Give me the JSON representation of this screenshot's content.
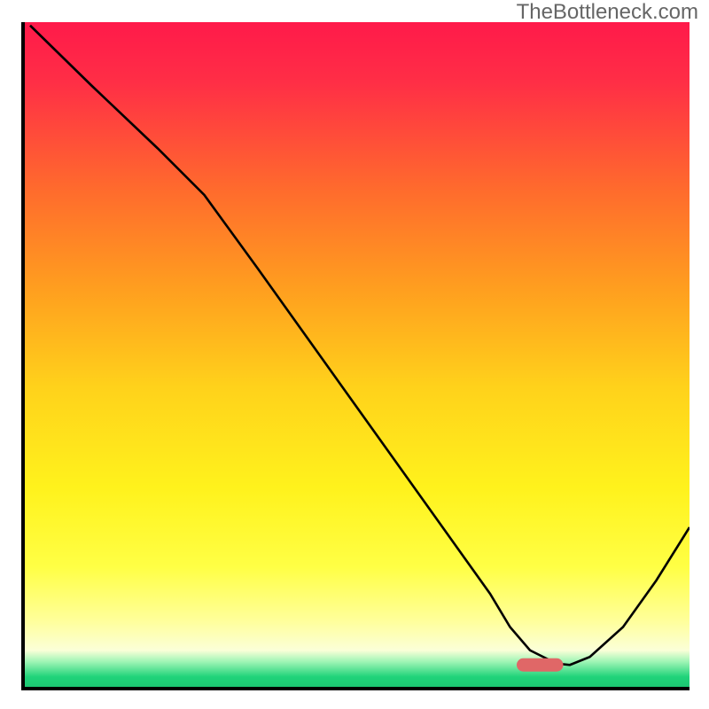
{
  "watermark": "TheBottleneck.com",
  "chart_data": {
    "type": "line",
    "title": "",
    "xlabel": "",
    "ylabel": "",
    "xlim": [
      0,
      100
    ],
    "ylim": [
      0,
      100
    ],
    "grid": false,
    "annotations": [],
    "series": [
      {
        "name": "curve",
        "x": [
          0.8,
          10,
          20,
          27,
          35,
          45,
          55,
          65,
          70,
          73,
          76,
          80,
          82,
          85,
          90,
          95,
          100
        ],
        "y": [
          99.5,
          90.5,
          81,
          74,
          63,
          49,
          35,
          21,
          14,
          9,
          5.5,
          3.5,
          3.3,
          4.5,
          9,
          16,
          24
        ],
        "color": "#000000"
      }
    ],
    "marker": {
      "shape": "rounded-rect",
      "x_center": 77.5,
      "y_center": 3.3,
      "width": 7,
      "height": 2,
      "color": "#e06767"
    },
    "background_gradient": {
      "stops": [
        {
          "offset": 0.0,
          "color": "#ff1a4a"
        },
        {
          "offset": 0.09,
          "color": "#ff2e46"
        },
        {
          "offset": 0.25,
          "color": "#ff6a2d"
        },
        {
          "offset": 0.4,
          "color": "#ff9e1f"
        },
        {
          "offset": 0.55,
          "color": "#ffd21b"
        },
        {
          "offset": 0.7,
          "color": "#fff21c"
        },
        {
          "offset": 0.82,
          "color": "#ffff45"
        },
        {
          "offset": 0.9,
          "color": "#ffff9a"
        },
        {
          "offset": 0.945,
          "color": "#fbffd8"
        },
        {
          "offset": 0.962,
          "color": "#9ff5b5"
        },
        {
          "offset": 0.985,
          "color": "#20d37a"
        },
        {
          "offset": 1.0,
          "color": "#1cc773"
        }
      ]
    }
  }
}
